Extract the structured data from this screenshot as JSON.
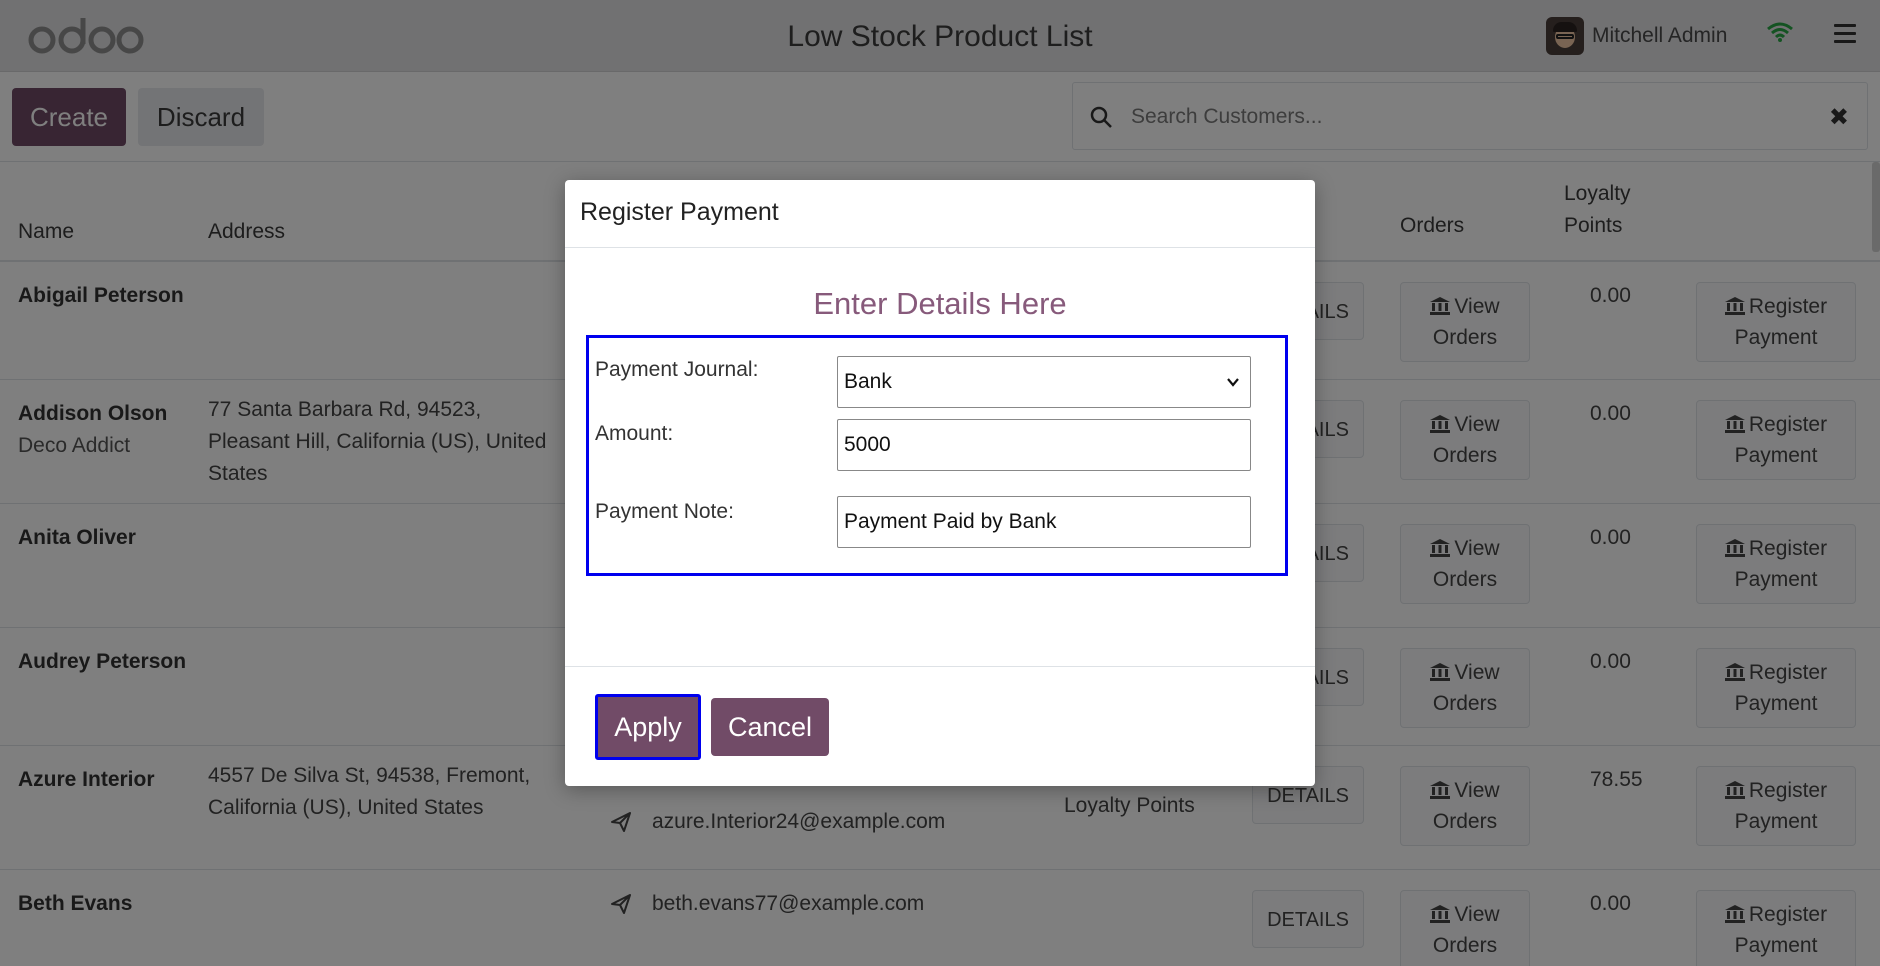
{
  "navbar": {
    "brand": "odoo",
    "title": "Low Stock Product List",
    "user_name": "Mitchell Admin"
  },
  "controls": {
    "create_label": "Create",
    "discard_label": "Discard",
    "search_placeholder": "Search Customers...",
    "clear_symbol": "✖"
  },
  "table": {
    "headers": {
      "name": "Name",
      "address": "Address",
      "orders": "Orders",
      "loyalty_1": "Loyalty",
      "loyalty_2": "Points"
    },
    "rows": [
      {
        "name": "Abigail Peterson",
        "company": "",
        "address": "",
        "email": "",
        "points": "0.00",
        "details": "DETAILS"
      },
      {
        "name": "Addison Olson",
        "company": "Deco Addict",
        "address": "77 Santa Barbara Rd, 94523, Pleasant Hill, California (US), United States",
        "email": "",
        "points": "0.00",
        "details": "DETAILS"
      },
      {
        "name": "Anita Oliver",
        "company": "",
        "address": "",
        "email": "",
        "points": "0.00",
        "details": "DETAILS"
      },
      {
        "name": "Audrey Peterson",
        "company": "",
        "address": "",
        "email": "",
        "points": "0.00",
        "details": "DETAILS"
      },
      {
        "name": "Azure Interior",
        "company": "",
        "address": "4557 De Silva St, 94538, Fremont, California (US), United States",
        "email": "azure.Interior24@example.com",
        "loyalty_text": "Loyalty Points",
        "points": "78.55",
        "details": "DETAILS"
      },
      {
        "name": "Beth Evans",
        "company": "",
        "address": "",
        "email": "beth.evans77@example.com",
        "points": "0.00",
        "details": "DETAILS"
      }
    ],
    "view_orders_1": "View",
    "view_orders_2": "Orders",
    "register_1": "Register",
    "register_2": "Payment"
  },
  "modal": {
    "title": "Register Payment",
    "subtitle": "Enter Details Here",
    "journal_label": "Payment Journal:",
    "journal_value": "Bank",
    "amount_label": "Amount:",
    "amount_value": "5000",
    "note_label": "Payment Note:",
    "note_value": "Payment Paid by Bank",
    "apply_label": "Apply",
    "cancel_label": "Cancel"
  },
  "colors": {
    "primary": "#714b67",
    "accent_text": "#875a7b",
    "focus_outline": "#0000ee",
    "wifi": "#28a745"
  }
}
